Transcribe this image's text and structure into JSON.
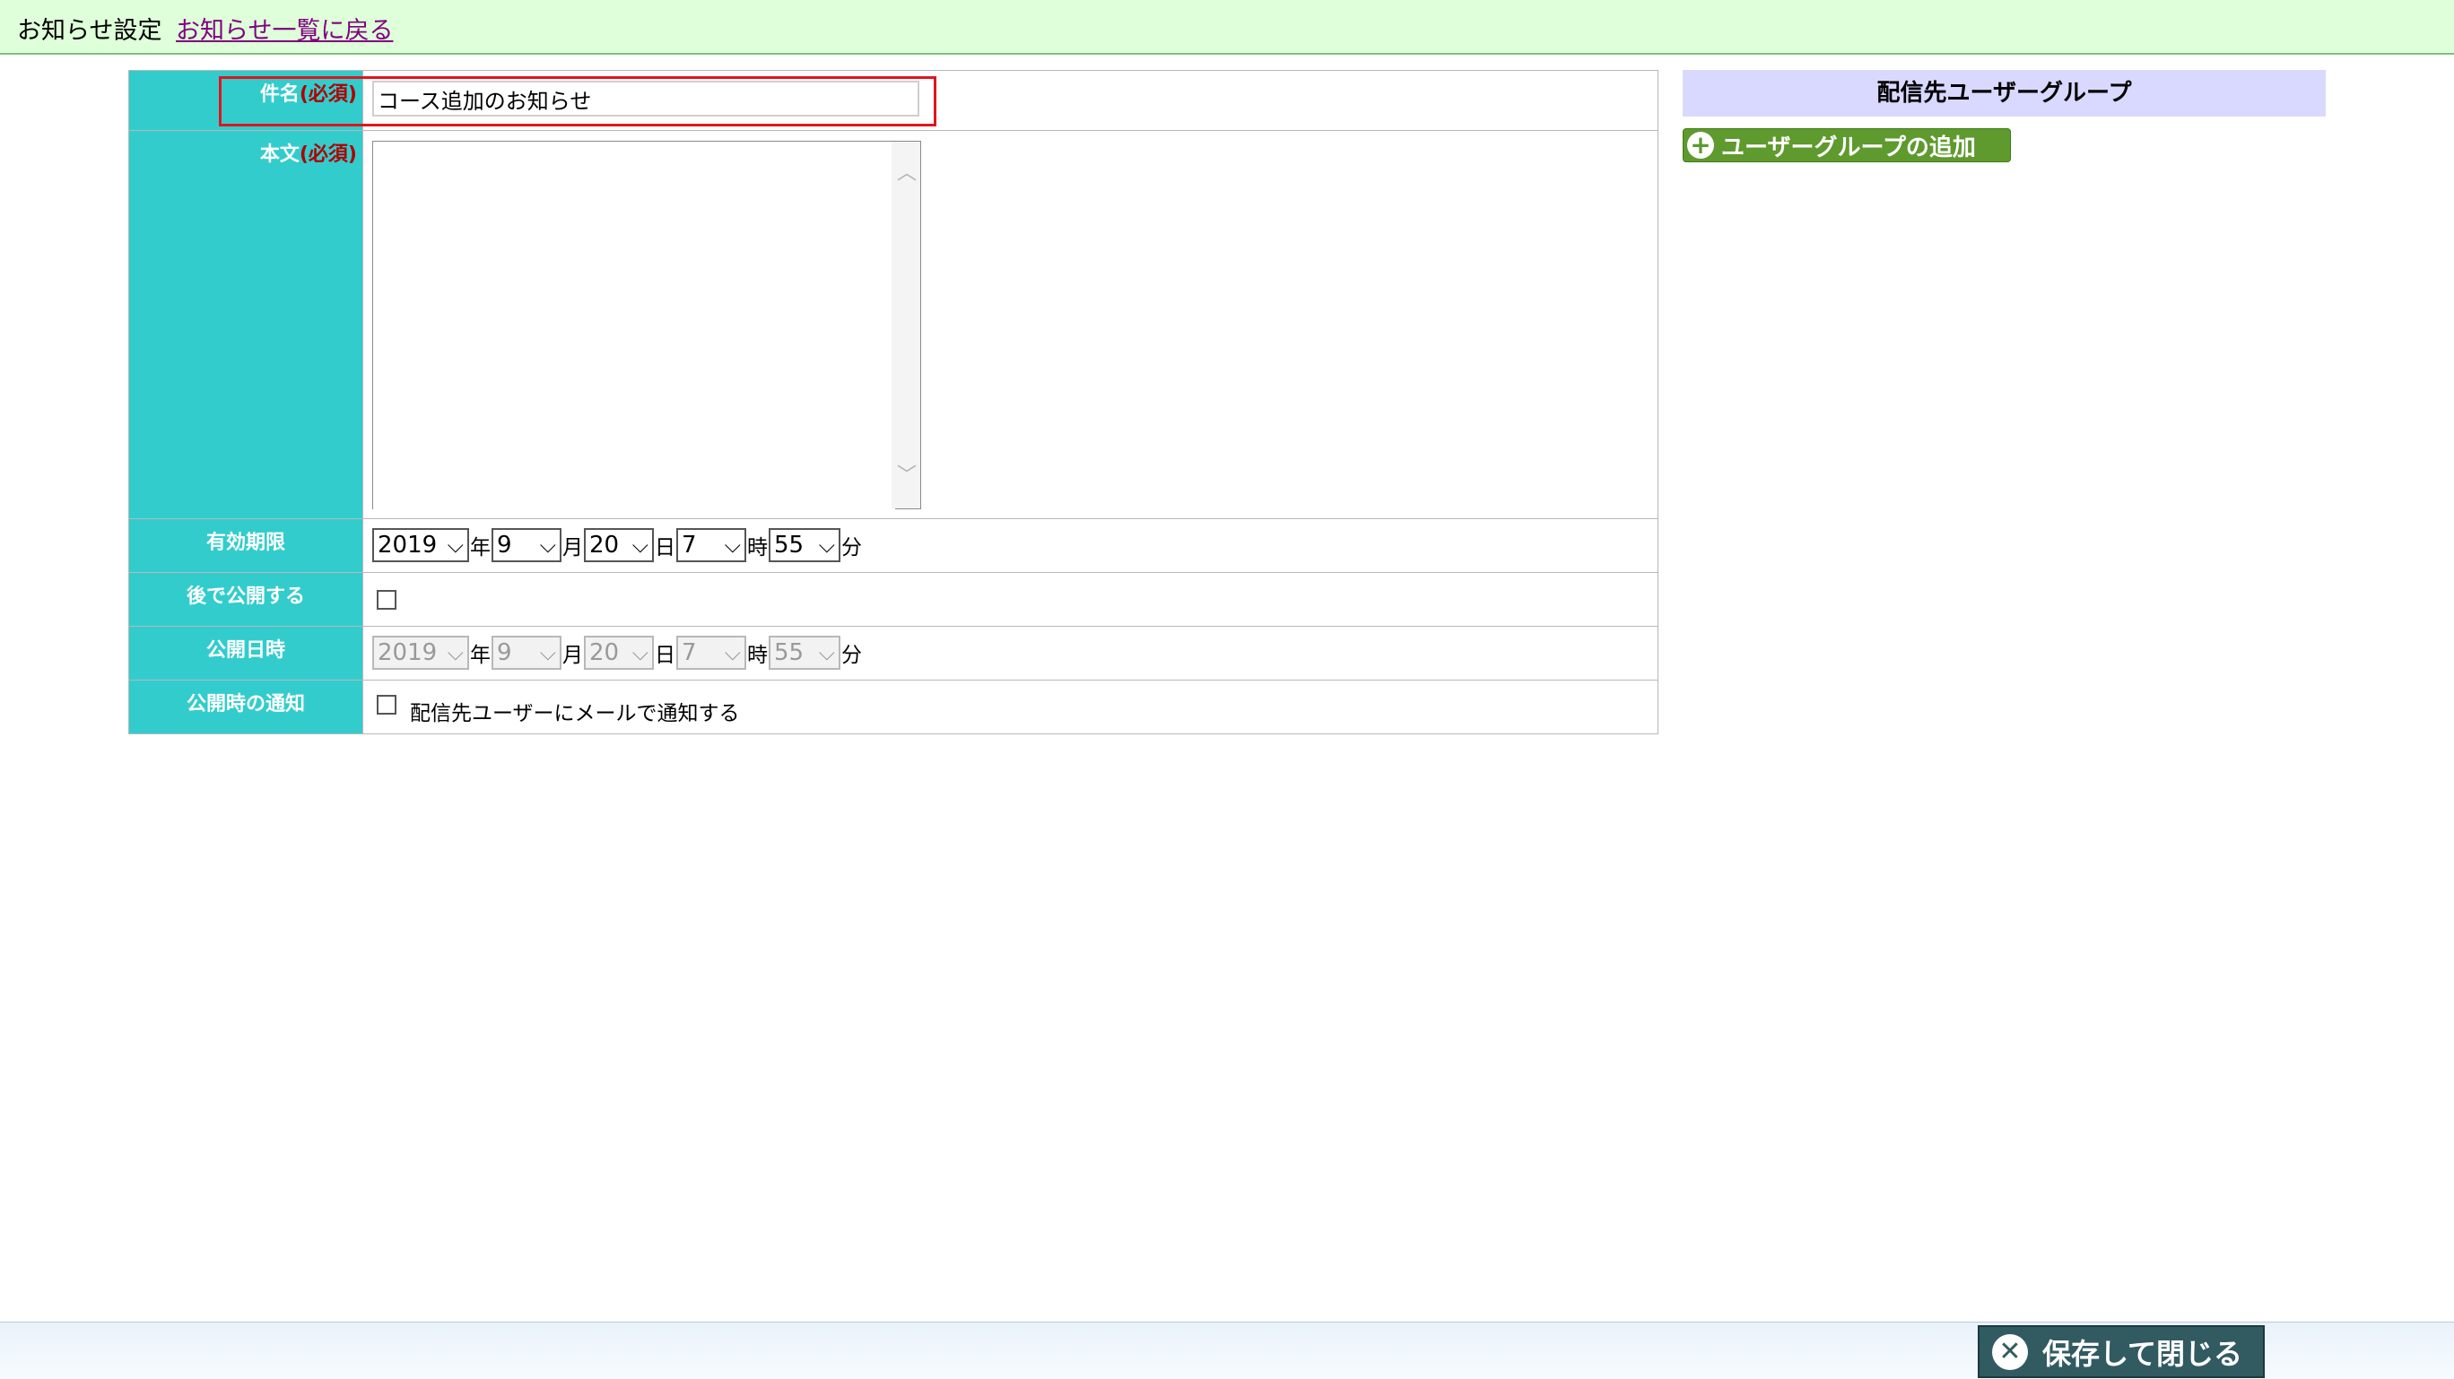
{
  "header": {
    "title": "お知らせ設定",
    "back_link": "お知らせ一覧に戻る"
  },
  "form": {
    "subject": {
      "label": "件名",
      "required": "(必須)",
      "value": "コース追加のお知らせ"
    },
    "body": {
      "label": "本文",
      "required": "(必須)",
      "value": ""
    },
    "expiry": {
      "label": "有効期限",
      "year": "2019",
      "month": "9",
      "day": "20",
      "hour": "7",
      "minute": "55"
    },
    "publish_later": {
      "label": "後で公開する",
      "checked": false
    },
    "publish_datetime": {
      "label": "公開日時",
      "year": "2019",
      "month": "9",
      "day": "20",
      "hour": "7",
      "minute": "55",
      "disabled": true
    },
    "notify": {
      "label": "公開時の通知",
      "checkbox_label": "配信先ユーザーにメールで通知する",
      "checked": false
    },
    "units": {
      "year": "年",
      "month": "月",
      "day": "日",
      "hour": "時",
      "minute": "分"
    }
  },
  "side_panel": {
    "title": "配信先ユーザーグループ",
    "add_button": "ユーザーグループの追加"
  },
  "footer": {
    "save_close": "保存して閉じる"
  },
  "colors": {
    "label_bg": "#33cccc",
    "required": "#b00000",
    "header_bg": "#deffd9",
    "panel_head_bg": "#d9d9ff",
    "add_button": "#5e9a2d",
    "save_button": "#315b61",
    "highlight": "#e0151f"
  },
  "icons": {
    "select_arrow": "chevron-down-icon",
    "add": "plus-circle-icon",
    "close": "close-circle-icon"
  }
}
